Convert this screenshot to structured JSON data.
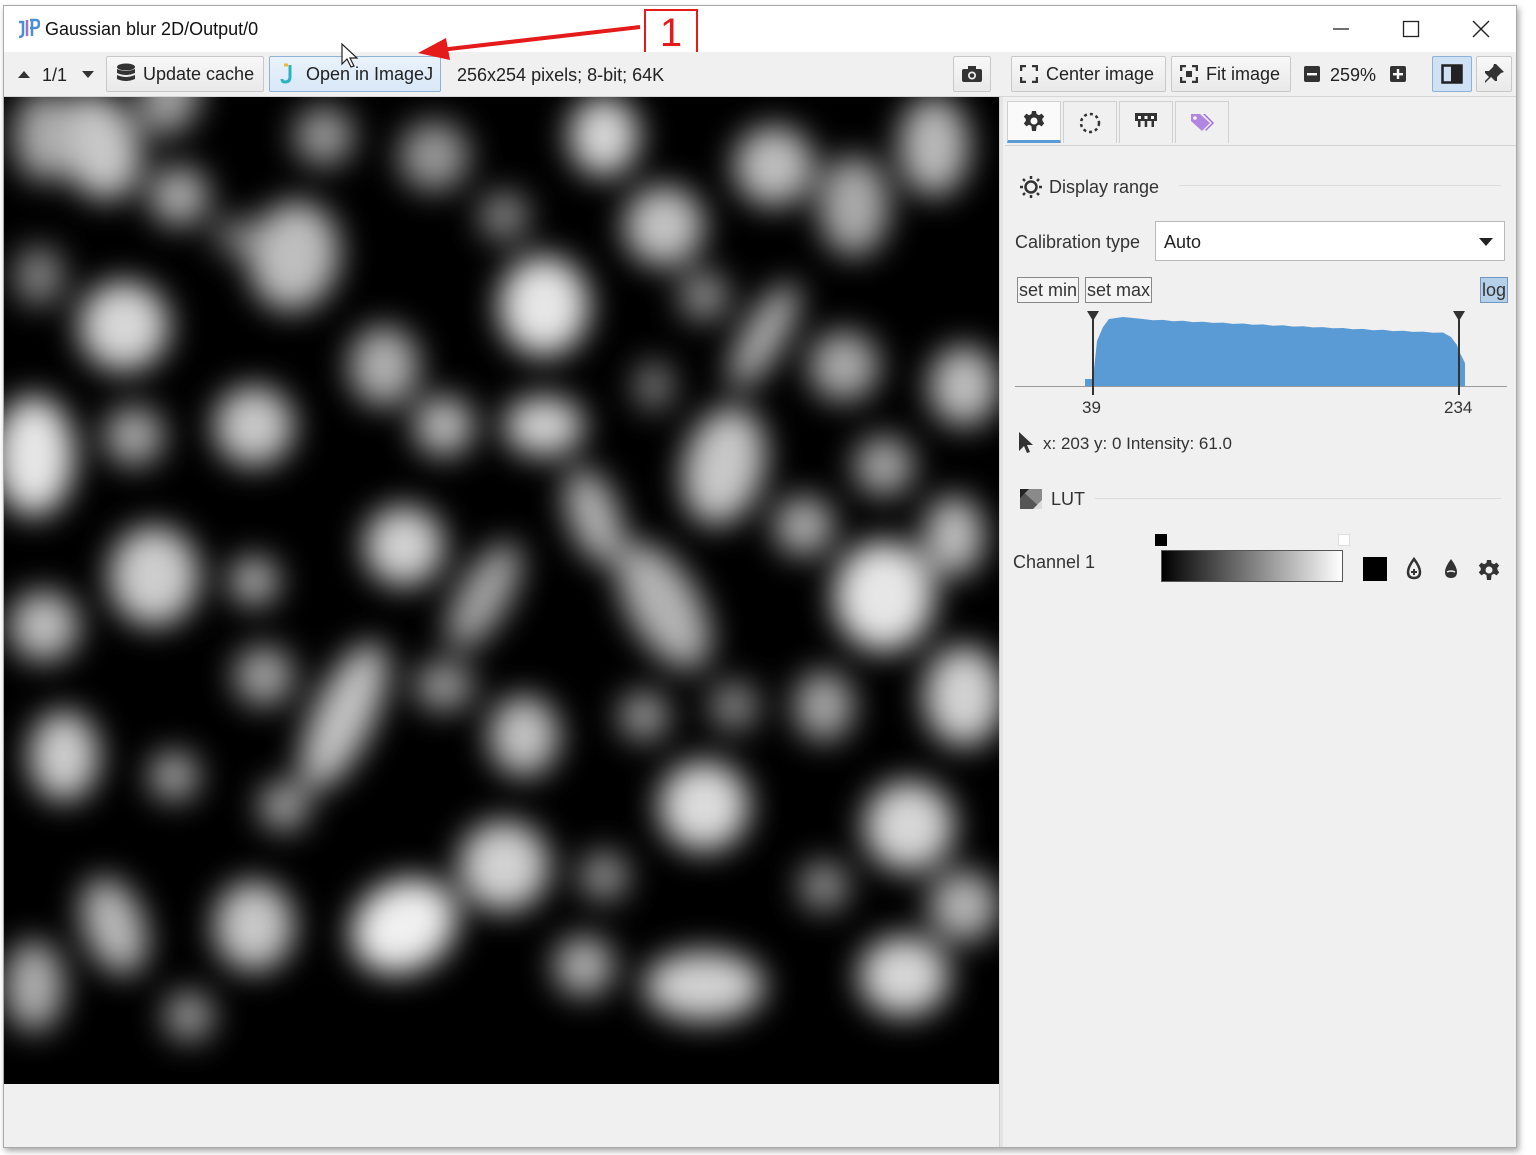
{
  "window": {
    "title": "Gaussian blur 2D/Output/0"
  },
  "toolbar": {
    "page_counter": "1/1",
    "update_cache_label": "Update cache",
    "open_imagej_label": "Open in ImageJ",
    "image_info": "256x254 pixels; 8-bit; 64K",
    "center_image_label": "Center image",
    "fit_image_label": "Fit image",
    "zoom_level": "259%"
  },
  "annotation": {
    "number": "1",
    "color": "#e51a1a"
  },
  "side_panel": {
    "tabs": [
      {
        "icon": "gear-icon"
      },
      {
        "icon": "dotted-circle-icon"
      },
      {
        "icon": "measure-icon"
      },
      {
        "icon": "tags-icon"
      }
    ],
    "display_range": {
      "title": "Display range",
      "calibration_label": "Calibration type",
      "calibration_value": "Auto",
      "set_min_label": "set min",
      "set_max_label": "set max",
      "log_label": "log",
      "log_enabled": true,
      "min_value": "39",
      "max_value": "234",
      "cursor_info": "x: 203 y: 0 Intensity: 61.0",
      "histogram_color": "#5b9bd5"
    },
    "lut": {
      "title": "LUT",
      "channel_label": "Channel 1",
      "gradient_start": "#000000",
      "gradient_end": "#ffffff"
    }
  },
  "colors": {
    "accent": "#5b9bd5",
    "annotation_red": "#e51a1a",
    "logo_blue": "#4a8fd6",
    "logo_purple": "#9b6fd6"
  }
}
